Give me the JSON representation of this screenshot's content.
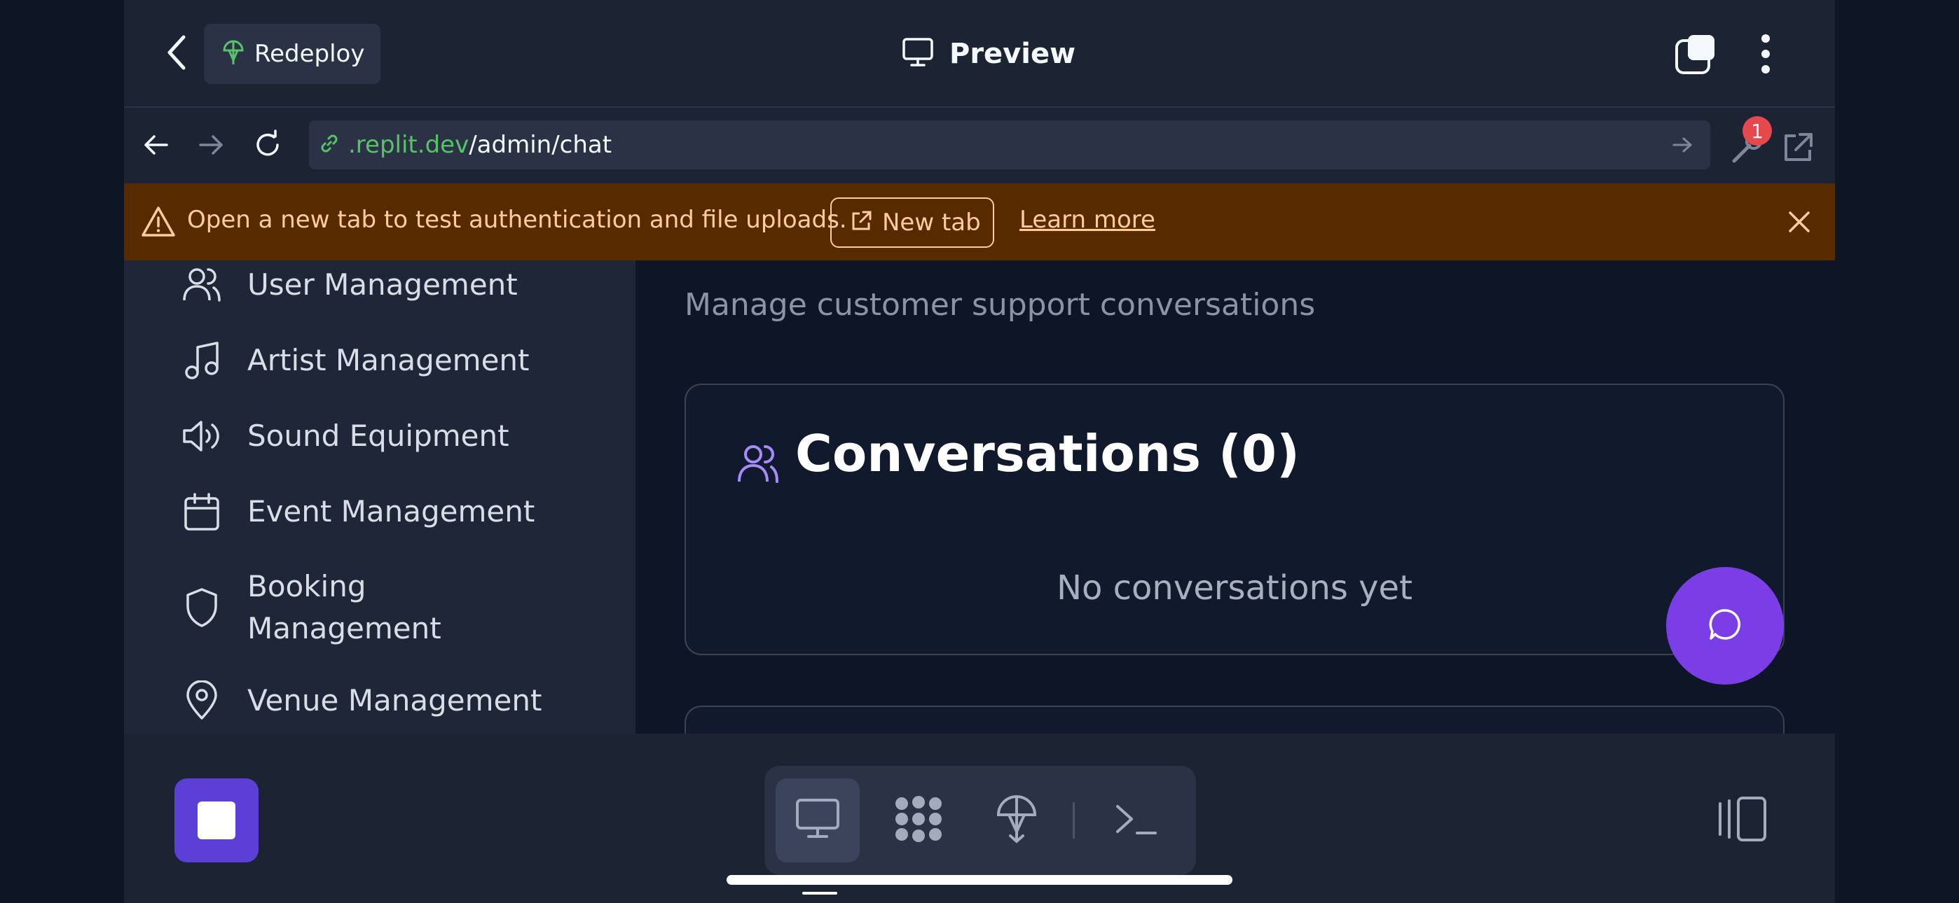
{
  "topbar": {
    "redeploy_label": "Redeploy",
    "preview_label": "Preview"
  },
  "urlbar": {
    "host": ".replit.dev",
    "path": "/admin/chat",
    "notification_count": "1"
  },
  "banner": {
    "message": "Open a new tab to test authentication and file uploads.",
    "new_tab_label": "New tab",
    "learn_more_label": "Learn more"
  },
  "sidebar": {
    "items": [
      {
        "label": "User Management",
        "icon": "users-icon"
      },
      {
        "label": "Artist Management",
        "icon": "music-icon"
      },
      {
        "label": "Sound Equipment",
        "icon": "speaker-icon"
      },
      {
        "label": "Event Management",
        "icon": "calendar-icon"
      },
      {
        "label": "Booking Management",
        "icon": "shield-icon"
      },
      {
        "label": "Venue Management",
        "icon": "map-pin-icon"
      }
    ]
  },
  "main": {
    "subtitle": "Manage customer support conversations",
    "conversations_title": "Conversations (0)",
    "empty_text": "No conversations yet"
  },
  "colors": {
    "accent": "#7b3ee6",
    "stop_button": "#5b3fd6",
    "banner_bg": "#572a00",
    "banner_text": "#ffcc9a",
    "url_host": "#58c26a"
  }
}
